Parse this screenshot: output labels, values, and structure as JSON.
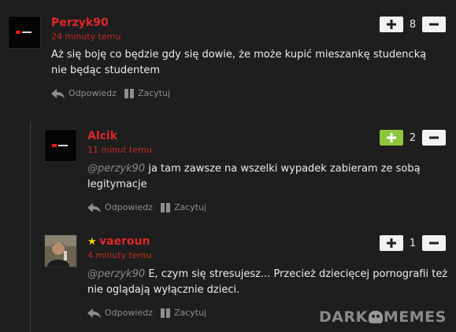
{
  "comments": [
    {
      "username": "Perzyk90",
      "time": "24 minuty temu",
      "mention": "",
      "text": "Aż się boję co będzie gdy się dowie, że może kupić mieszankę studencką nie będąc studentem",
      "votes": "8",
      "reply_label": "Odpowiedz",
      "quote_label": "Zacytuj"
    },
    {
      "username": "Alcik",
      "time": "11 minut temu",
      "mention": "@perzyk90",
      "text": "ja tam zawsze na wszelki wypadek zabieram ze sobą legitymacje",
      "votes": "2",
      "reply_label": "Odpowiedz",
      "quote_label": "Zacytuj"
    },
    {
      "username": "vaeroun",
      "time": "4 minuty temu",
      "mention": "@perzyk90",
      "text": "E, czym się stresujesz... Przecież dziecięcej pornografii też nie oglądają wyłącznie dzieci.",
      "votes": "1",
      "reply_label": "Odpowiedz",
      "quote_label": "Zacytuj"
    }
  ],
  "watermark": {
    "left": "DARK",
    "right": "MEMES"
  },
  "colors": {
    "upvote_active": "#8cc63f",
    "username": "#e0262a",
    "star": "#f5d000"
  }
}
